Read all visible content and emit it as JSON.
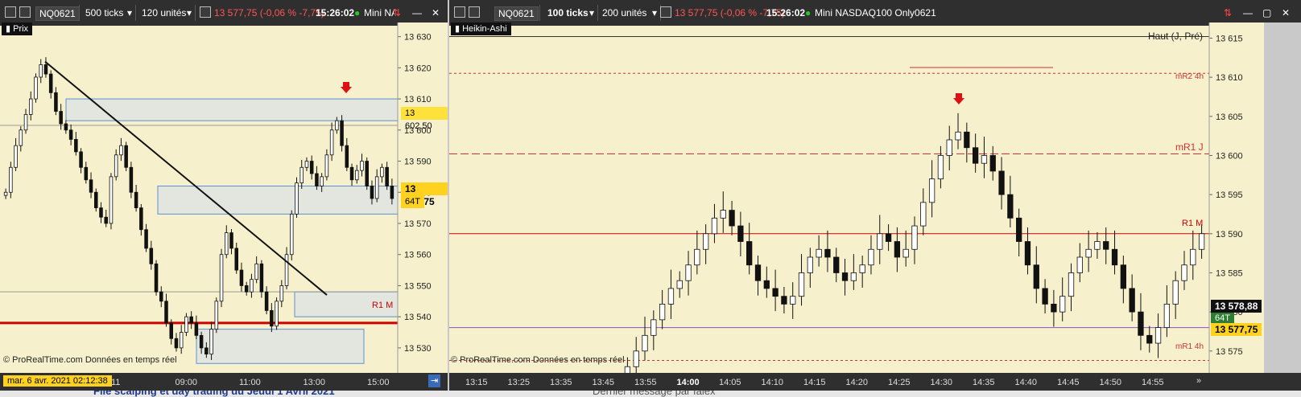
{
  "left": {
    "toolbar": {
      "symbol": "NQ0621",
      "ticks": "500 ticks",
      "units": "120 unités",
      "price_info": "13 577,75 (-0,06 % -7,75)",
      "time": "15:26:02",
      "product": "Mini NA"
    },
    "panel_label": "Prix",
    "credit": "© ProRealTime.com  Données en temps réel",
    "date_label": "mar. 6 avr. 2021 02:12:38",
    "x_ticks": [
      "11",
      "09:00",
      "11:00",
      "13:00",
      "15:00"
    ],
    "y_ticks": [
      "13 630",
      "13 620",
      "13 610",
      "13 600",
      "13 590",
      "13 580",
      "13 570",
      "13 560",
      "13 550",
      "13 540",
      "13 530"
    ],
    "price_tags": {
      "high": "13 602,50",
      "last": "13 577,75",
      "ticks": "64T"
    },
    "level_label": "R1 M"
  },
  "right": {
    "toolbar": {
      "symbol": "NQ0621",
      "ticks": "100 ticks",
      "units": "200 unités",
      "price_info": "13 577,75 (-0,06 % -7,75)",
      "time": "15:26:02",
      "product": "Mini NASDAQ100 Only0621"
    },
    "panel_label": "Heikin-Ashi",
    "header_right": "Haut (J, Pré)",
    "credit": "© ProRealTime.com  Données en temps réel",
    "x_ticks": [
      "13:15",
      "13:25",
      "13:35",
      "13:45",
      "13:55",
      "14:00",
      "14:05",
      "14:10",
      "14:15",
      "14:20",
      "14:25",
      "14:30",
      "14:35",
      "14:40",
      "14:45",
      "14:50",
      "14:55"
    ],
    "y_ticks": [
      "13 615",
      "13 610",
      "13 605",
      "13 600",
      "13 595",
      "13 590",
      "13 585",
      "13 580",
      "13 575"
    ],
    "level_labels": {
      "mr2": "mR2 4h",
      "mr1j": "mR1 J",
      "r1": "R1 M",
      "mr1": "mR1 4h"
    },
    "price_tags": {
      "cursor": "13 578,88",
      "ticks": "64T",
      "last": "13 577,75"
    }
  },
  "footer": {
    "left_text": "File scalping et day trading du Jeudi 1 Avril 2021",
    "right_text": "Dernier message par falex"
  },
  "chart_data": [
    {
      "type": "candlestick",
      "ylim": [
        13523,
        13633
      ],
      "x_ticks": [
        "11",
        "09:00",
        "11:00",
        "13:00",
        "15:00"
      ],
      "levels": [
        {
          "value": 13538,
          "label": "R1 M",
          "color": "#cc0000"
        },
        {
          "value": 13601.5,
          "color": "#999999"
        },
        {
          "value": 13548,
          "color": "#999999"
        }
      ],
      "trendline": [
        [
          0,
          13622
        ],
        [
          1,
          13547
        ]
      ],
      "zones": [
        {
          "from": 13603,
          "to": 13610
        },
        {
          "from": 13573,
          "to": 13582
        },
        {
          "from": 13540,
          "to": 13548
        },
        {
          "from": 13525,
          "to": 13536
        }
      ],
      "closes": [
        13580,
        13588,
        13595,
        13600,
        13605,
        13610,
        13617,
        13621,
        13618,
        13612,
        13606,
        13602,
        13600,
        13597,
        13593,
        13588,
        13584,
        13580,
        13575,
        13572,
        13570,
        13585,
        13592,
        13595,
        13588,
        13580,
        13575,
        13568,
        13562,
        13557,
        13548,
        13545,
        13538,
        13533,
        13530,
        13535,
        13540,
        13538,
        13534,
        13530,
        13528,
        13536,
        13545,
        13560,
        13567,
        13562,
        13555,
        13550,
        13548,
        13552,
        13557,
        13548,
        13542,
        13537,
        13545,
        13550,
        13560,
        13573,
        13583,
        13588,
        13590,
        13586,
        13582,
        13585,
        13592,
        13600,
        13603,
        13595,
        13588,
        13584,
        13587,
        13590,
        13582,
        13578,
        13585,
        13588,
        13582,
        13578
      ]
    },
    {
      "type": "heikin-ashi",
      "ylim": [
        13572,
        13617
      ],
      "x_ticks": [
        "13:15",
        "13:25",
        "13:35",
        "13:45",
        "13:55",
        "14:00",
        "14:05",
        "14:10",
        "14:15",
        "14:20",
        "14:25",
        "14:30",
        "14:35",
        "14:40",
        "14:45",
        "14:50",
        "14:55"
      ],
      "levels": [
        {
          "value": 13615.2,
          "label": "Haut (J, Pré)",
          "color": "#333333"
        },
        {
          "value": 13610.5,
          "label": "mR2 4h",
          "color": "#cc3333"
        },
        {
          "value": 13600.2,
          "label": "mR1 J",
          "color": "#cc3333"
        },
        {
          "value": 13590,
          "label": "R1 M",
          "color": "#cc0000"
        },
        {
          "value": 13578,
          "color": "#8855cc"
        },
        {
          "value": 13573.8,
          "label": "mR1 4h",
          "color": "#cc3333"
        }
      ],
      "closes": [
        13573,
        13575,
        13577,
        13579,
        13581,
        13583,
        13584,
        13586,
        13588,
        13590,
        13592,
        13593,
        13591,
        13589,
        13586,
        13584,
        13583,
        13582,
        13581,
        13582,
        13585,
        13587,
        13588,
        13587,
        13585,
        13584,
        13585,
        13586,
        13588,
        13590,
        13589,
        13587,
        13588,
        13591,
        13594,
        13597,
        13600,
        13602,
        13603,
        13601,
        13599,
        13600,
        13598,
        13595,
        13592,
        13589,
        13586,
        13583,
        13581,
        13580,
        13582,
        13585,
        13587,
        13588,
        13589,
        13588,
        13586,
        13583,
        13580,
        13577,
        13576,
        13578,
        13581,
        13584,
        13586,
        13588,
        13590
      ]
    }
  ]
}
